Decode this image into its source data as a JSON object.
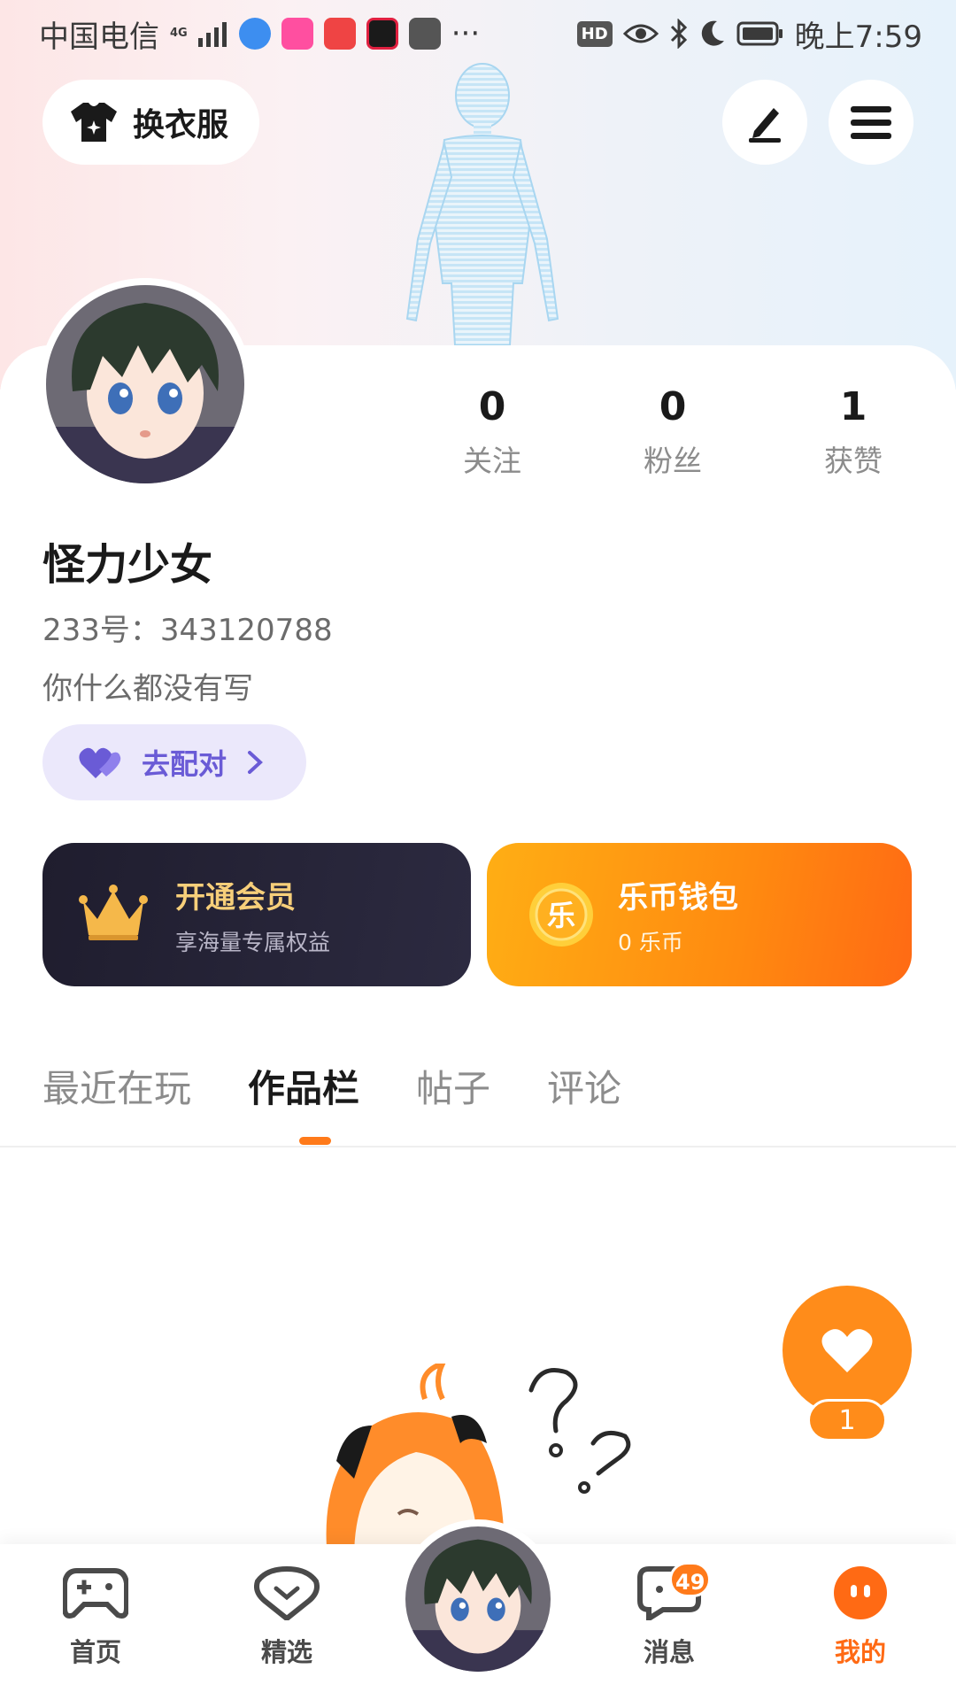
{
  "status_bar": {
    "carrier": "中国电信",
    "network": "4G",
    "more": "···",
    "hd": "HD",
    "time": "晚上7:59"
  },
  "header": {
    "outfit_label": "换衣服",
    "edit_icon": "pen-icon",
    "menu_icon": "menu-icon"
  },
  "profile": {
    "stats": [
      {
        "value": "0",
        "label": "关注"
      },
      {
        "value": "0",
        "label": "粉丝"
      },
      {
        "value": "1",
        "label": "获赞"
      }
    ],
    "nickname": "怪力少女",
    "uid": "233号：343120788",
    "bio": "你什么都没有写",
    "match_label": "去配对"
  },
  "cards": {
    "vip": {
      "title": "开通会员",
      "subtitle": "享海量专属权益",
      "title_color": "#f7cf7a"
    },
    "wallet": {
      "title": "乐币钱包",
      "subtitle": "0 乐币",
      "coin_char": "乐"
    }
  },
  "tabs": [
    {
      "label": "最近在玩",
      "active": false
    },
    {
      "label": "作品栏",
      "active": true
    },
    {
      "label": "帖子",
      "active": false
    },
    {
      "label": "评论",
      "active": false
    }
  ],
  "like_fab": {
    "count": "1"
  },
  "bottom_nav": [
    {
      "label": "首页",
      "icon": "gamepad-icon"
    },
    {
      "label": "精选",
      "icon": "heart-chat-icon"
    },
    {
      "label": "",
      "icon": "avatar"
    },
    {
      "label": "消息",
      "icon": "message-icon",
      "badge": "49"
    },
    {
      "label": "我的",
      "icon": "face-icon",
      "active": true
    }
  ],
  "colors": {
    "accent": "#ff7a1a",
    "match_purple": "#6a5bd6"
  }
}
